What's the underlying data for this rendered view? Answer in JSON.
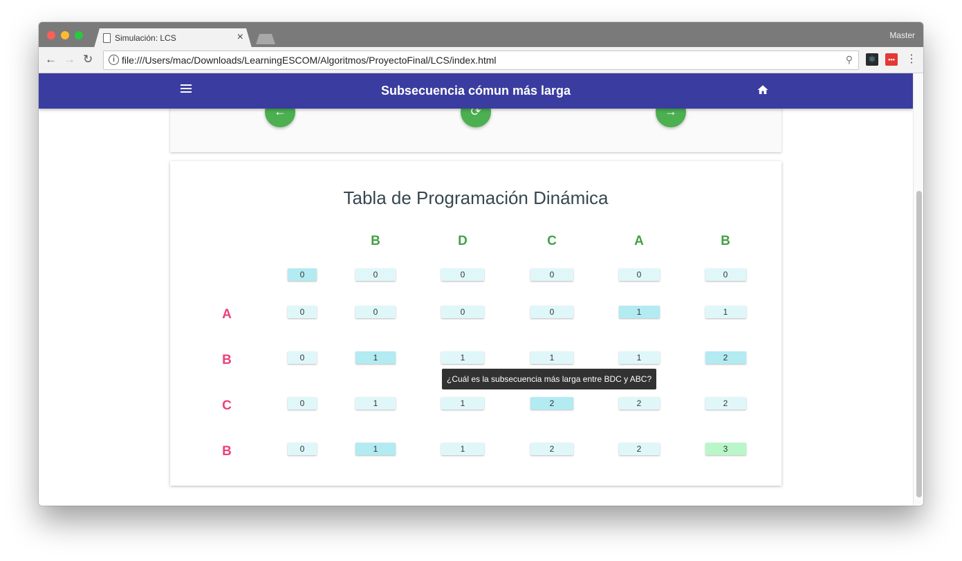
{
  "browser": {
    "tab_title": "Simulación: LCS",
    "tab_close": "×",
    "profile_name": "Master",
    "url": "file:///Users/mac/Downloads/LearningESCOM/Algoritmos/ProyectoFinal/LCS/index.html",
    "nav": {
      "back": "←",
      "forward": "→",
      "reload": "↻"
    },
    "info_glyph": "i",
    "zoom_glyph": "⚲",
    "extensions": [
      "react-devtools-icon",
      "lastpass-icon"
    ],
    "ext2_label": "•••",
    "menu_glyph": "⋮"
  },
  "app": {
    "title": "Subsecuencia cómun más larga",
    "icons": {
      "menu": "hamburger-menu-icon",
      "home": "home-icon"
    }
  },
  "controls": {
    "prev_glyph": "←",
    "reset_glyph": "⟳",
    "next_glyph": "→"
  },
  "table": {
    "title": "Tabla de Programación Dinámica",
    "columns": [
      "B",
      "D",
      "C",
      "A",
      "B"
    ],
    "rows": [
      "A",
      "B",
      "C",
      "B"
    ],
    "values": [
      [
        "0",
        "0",
        "0",
        "0",
        "0",
        "0"
      ],
      [
        "0",
        "0",
        "0",
        "0",
        "1",
        "1"
      ],
      [
        "0",
        "1",
        "1",
        "1",
        "1",
        "2"
      ],
      [
        "0",
        "1",
        "1",
        "2",
        "2",
        "2"
      ],
      [
        "0",
        "1",
        "1",
        "2",
        "2",
        "3"
      ]
    ],
    "highlighted_cells": [
      [
        0,
        0
      ],
      [
        1,
        4
      ],
      [
        2,
        1
      ],
      [
        2,
        5
      ],
      [
        3,
        3
      ],
      [
        4,
        1
      ]
    ],
    "result_cell": [
      4,
      5
    ],
    "colors": {
      "column_header": "#43a047",
      "row_header": "#ec407a",
      "cell": "#e0f7fa",
      "cell_highlight": "#b2ebf2",
      "cell_result": "#b9f6ca",
      "appbar": "#3a3d9f",
      "fab": "#4caf50"
    }
  },
  "tooltip": "¿Cuál es la subsecuencia más larga entre BDC y ABC?"
}
